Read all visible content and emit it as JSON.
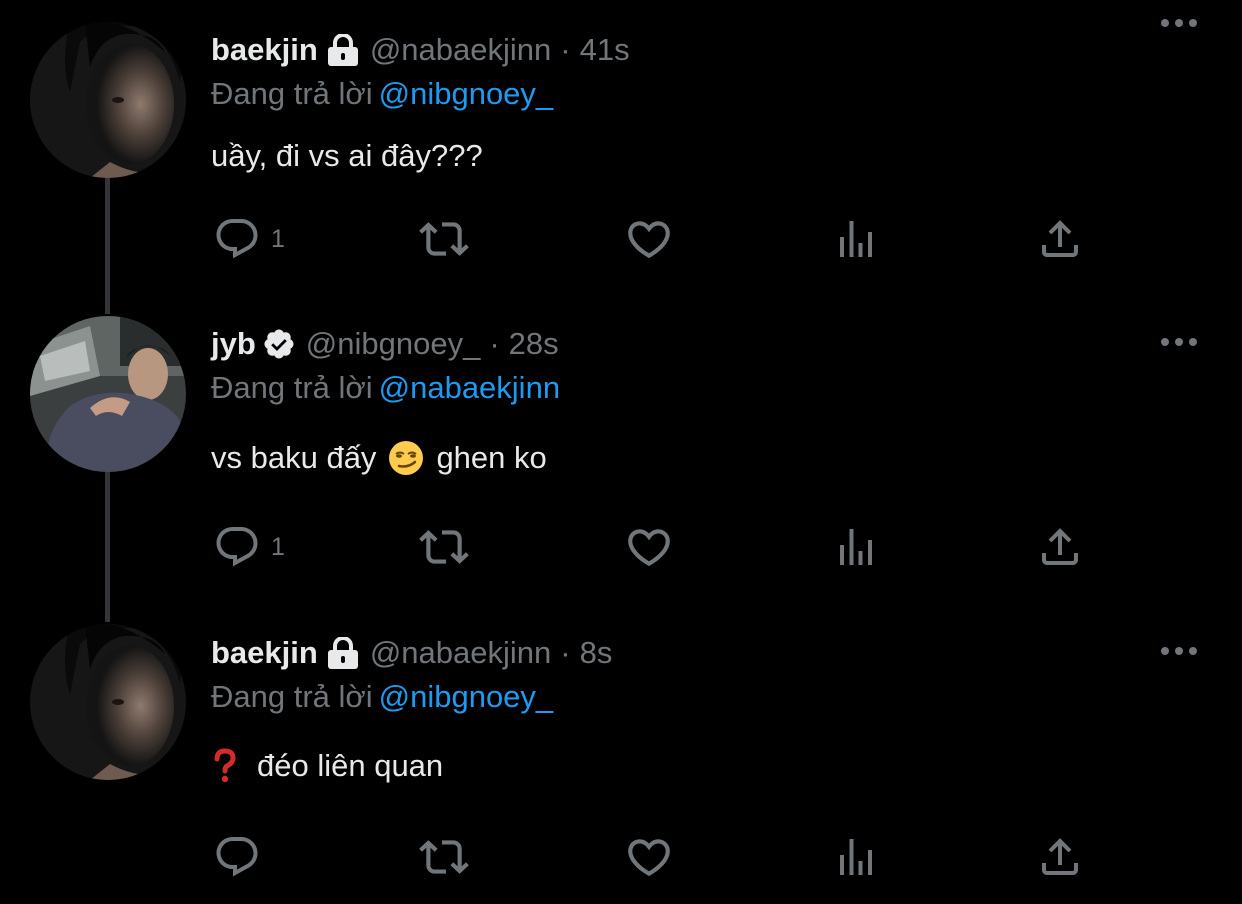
{
  "tweets": [
    {
      "name": "baekjin",
      "badge": "lock-icon",
      "handle": "@nabaekjinn",
      "separator": "·",
      "time": "41s",
      "reply_prefix": "Đang trả lời",
      "reply_to": "@nibgnoey_",
      "text": "uầy, đi vs ai đây???",
      "reply_count": "1"
    },
    {
      "name": "jyb",
      "badge": "verified-icon",
      "handle": "@nibgnoey_",
      "separator": "·",
      "time": "28s",
      "reply_prefix": "Đang trả lời",
      "reply_to": "@nabaekjinn",
      "text_before": "vs baku đấy",
      "emoji": "smirk-emoji",
      "text_after": "ghen ko",
      "reply_count": "1"
    },
    {
      "name": "baekjin",
      "badge": "lock-icon",
      "handle": "@nabaekjinn",
      "separator": "·",
      "time": "8s",
      "reply_prefix": "Đang trả lời",
      "reply_to": "@nibgnoey_",
      "emoji": "red-question-mark-emoji",
      "text": "đéo liên quan",
      "reply_count": ""
    }
  ],
  "colors": {
    "background": "#000000",
    "primary_text": "#e7e9ea",
    "secondary_text": "#71767b",
    "link": "#1d9bf0",
    "icon": "#71767b",
    "thread_line": "#333639"
  }
}
